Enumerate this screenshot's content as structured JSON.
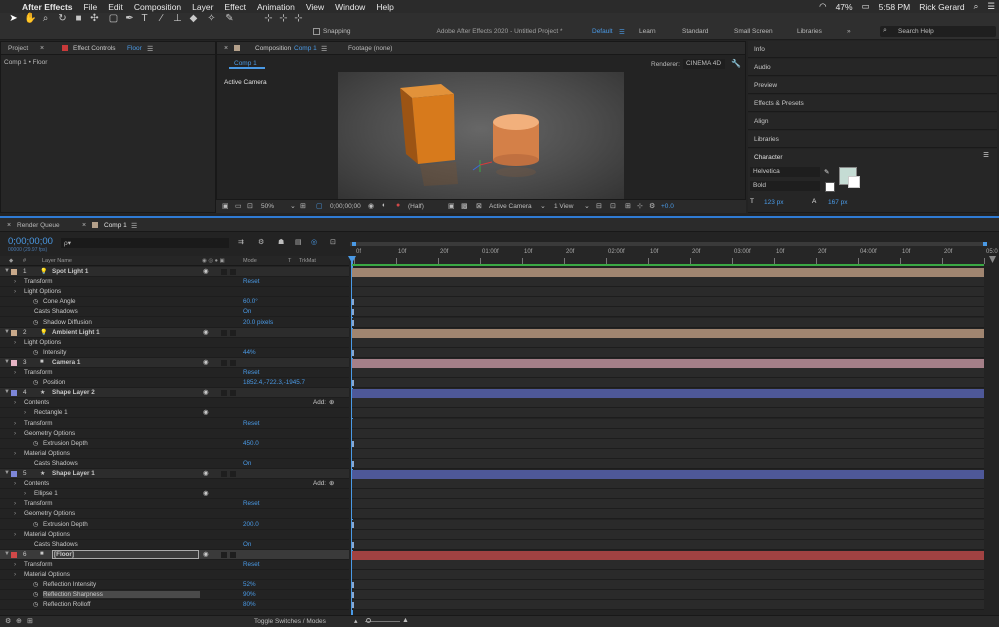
{
  "menubar": {
    "apple": "",
    "app": "After Effects",
    "items": [
      "File",
      "Edit",
      "Composition",
      "Layer",
      "Effect",
      "Animation",
      "View",
      "Window",
      "Help"
    ],
    "battery": "47%",
    "time": "5:58 PM",
    "user": "Rick Gerard"
  },
  "window_title": "Adobe After Effects 2020 - Untitled Project *",
  "toolbar": {
    "snapping": "Snapping"
  },
  "workspaces": {
    "default": "Default",
    "learn": "Learn",
    "standard": "Standard",
    "small_screen": "Small Screen",
    "libraries": "Libraries",
    "more": "»",
    "search": "Search Help"
  },
  "project_panel": {
    "tab_project": "Project",
    "tab_effect": "Effect Controls",
    "tab_effect_layer": "Floor",
    "subtitle": "Comp 1 • Floor"
  },
  "comp_panel": {
    "tab_comp": "Composition",
    "tab_comp_name": "Comp 1",
    "tab_footage": "Footage (none)",
    "comp_button": "Comp 1",
    "renderer_label": "Renderer:",
    "renderer": "CINEMA 4D",
    "camera_label": "Active Camera"
  },
  "viewer_bar": {
    "zoom": "50%",
    "timecode": "0;00;00;00",
    "resolution": "(Half)",
    "camera": "Active Camera",
    "views": "1 View",
    "exposure": "+0.0"
  },
  "right_panels": [
    "Info",
    "Audio",
    "Preview",
    "Effects & Presets",
    "Align",
    "Libraries",
    "Character"
  ],
  "character": {
    "font": "Helvetica",
    "style": "Bold",
    "size": "123 px",
    "leading": "167 px"
  },
  "timeline": {
    "tab_render": "Render Queue",
    "tab_comp": "Comp 1",
    "timecode": "0;00;00;00",
    "fps": "00000 (29.97 fps)",
    "search_placeholder": "ρ▾",
    "col_layer_name": "Layer Name",
    "col_mode": "Mode",
    "col_t": "T",
    "col_trkmat": "TrkMat",
    "col_hash": "#",
    "toggle_label": "Toggle Switches / Modes",
    "add_label": "Add:",
    "ruler": [
      "0f",
      "10f",
      "20f",
      "01:00f",
      "10f",
      "20f",
      "02:00f",
      "10f",
      "20f",
      "03:00f",
      "10f",
      "20f",
      "04:00f",
      "10f",
      "20f",
      "05:0"
    ]
  },
  "layers": [
    {
      "type": "layer",
      "num": "1",
      "name": "Spot Light 1",
      "color": "#c9a98a",
      "bar": "#a08570",
      "icon": "💡"
    },
    {
      "type": "group",
      "name": "Transform",
      "val": "Reset"
    },
    {
      "type": "group",
      "name": "Light Options",
      "val": ""
    },
    {
      "type": "prop",
      "name": "Cone Angle",
      "val": "60.0°"
    },
    {
      "type": "prop2",
      "name": "Casts Shadows",
      "val": "On"
    },
    {
      "type": "prop",
      "name": "Shadow Diffusion",
      "val": "20.0 pixels"
    },
    {
      "type": "layer",
      "num": "2",
      "name": "Ambient Light 1",
      "color": "#c9a98a",
      "bar": "#a08570",
      "icon": "💡"
    },
    {
      "type": "group",
      "name": "Light Options",
      "val": ""
    },
    {
      "type": "prop",
      "name": "Intensity",
      "val": "44%"
    },
    {
      "type": "layer",
      "num": "3",
      "name": "Camera 1",
      "color": "#e6b4c4",
      "bar": "#a47f88",
      "icon": "■"
    },
    {
      "type": "group",
      "name": "Transform",
      "val": "Reset"
    },
    {
      "type": "prop",
      "name": "Position",
      "val": "1852.4,-722.3,-1945.7"
    },
    {
      "type": "layer",
      "num": "4",
      "name": "Shape Layer 2",
      "color": "#7d86d8",
      "bar": "#4e5898",
      "icon": "★"
    },
    {
      "type": "group",
      "name": "Contents",
      "val": "",
      "add": true
    },
    {
      "type": "sub",
      "name": "Rectangle 1",
      "val": ""
    },
    {
      "type": "group",
      "name": "Transform",
      "val": "Reset"
    },
    {
      "type": "group",
      "name": "Geometry Options",
      "val": ""
    },
    {
      "type": "prop",
      "name": "Extrusion Depth",
      "val": "450.0"
    },
    {
      "type": "group",
      "name": "Material Options",
      "val": ""
    },
    {
      "type": "prop2",
      "name": "Casts Shadows",
      "val": "On"
    },
    {
      "type": "layer",
      "num": "5",
      "name": "Shape Layer 1",
      "color": "#7d86d8",
      "bar": "#4e5898",
      "icon": "★"
    },
    {
      "type": "group",
      "name": "Contents",
      "val": "",
      "add": true
    },
    {
      "type": "sub",
      "name": "Ellipse 1",
      "val": ""
    },
    {
      "type": "group",
      "name": "Transform",
      "val": "Reset"
    },
    {
      "type": "group",
      "name": "Geometry Options",
      "val": ""
    },
    {
      "type": "prop",
      "name": "Extrusion Depth",
      "val": "200.0"
    },
    {
      "type": "group",
      "name": "Material Options",
      "val": ""
    },
    {
      "type": "prop2",
      "name": "Casts Shadows",
      "val": "On"
    },
    {
      "type": "layer",
      "num": "6",
      "name": "[Floor]",
      "color": "#d04848",
      "bar": "#a04242",
      "icon": "■",
      "selected": true
    },
    {
      "type": "group",
      "name": "Transform",
      "val": "Reset"
    },
    {
      "type": "group",
      "name": "Material Options",
      "val": ""
    },
    {
      "type": "prop",
      "name": "Reflection Intensity",
      "val": "52%"
    },
    {
      "type": "prop",
      "name": "Reflection Sharpness",
      "val": "90%",
      "highlight": true
    },
    {
      "type": "prop",
      "name": "Reflection Rolloff",
      "val": "80%"
    }
  ]
}
